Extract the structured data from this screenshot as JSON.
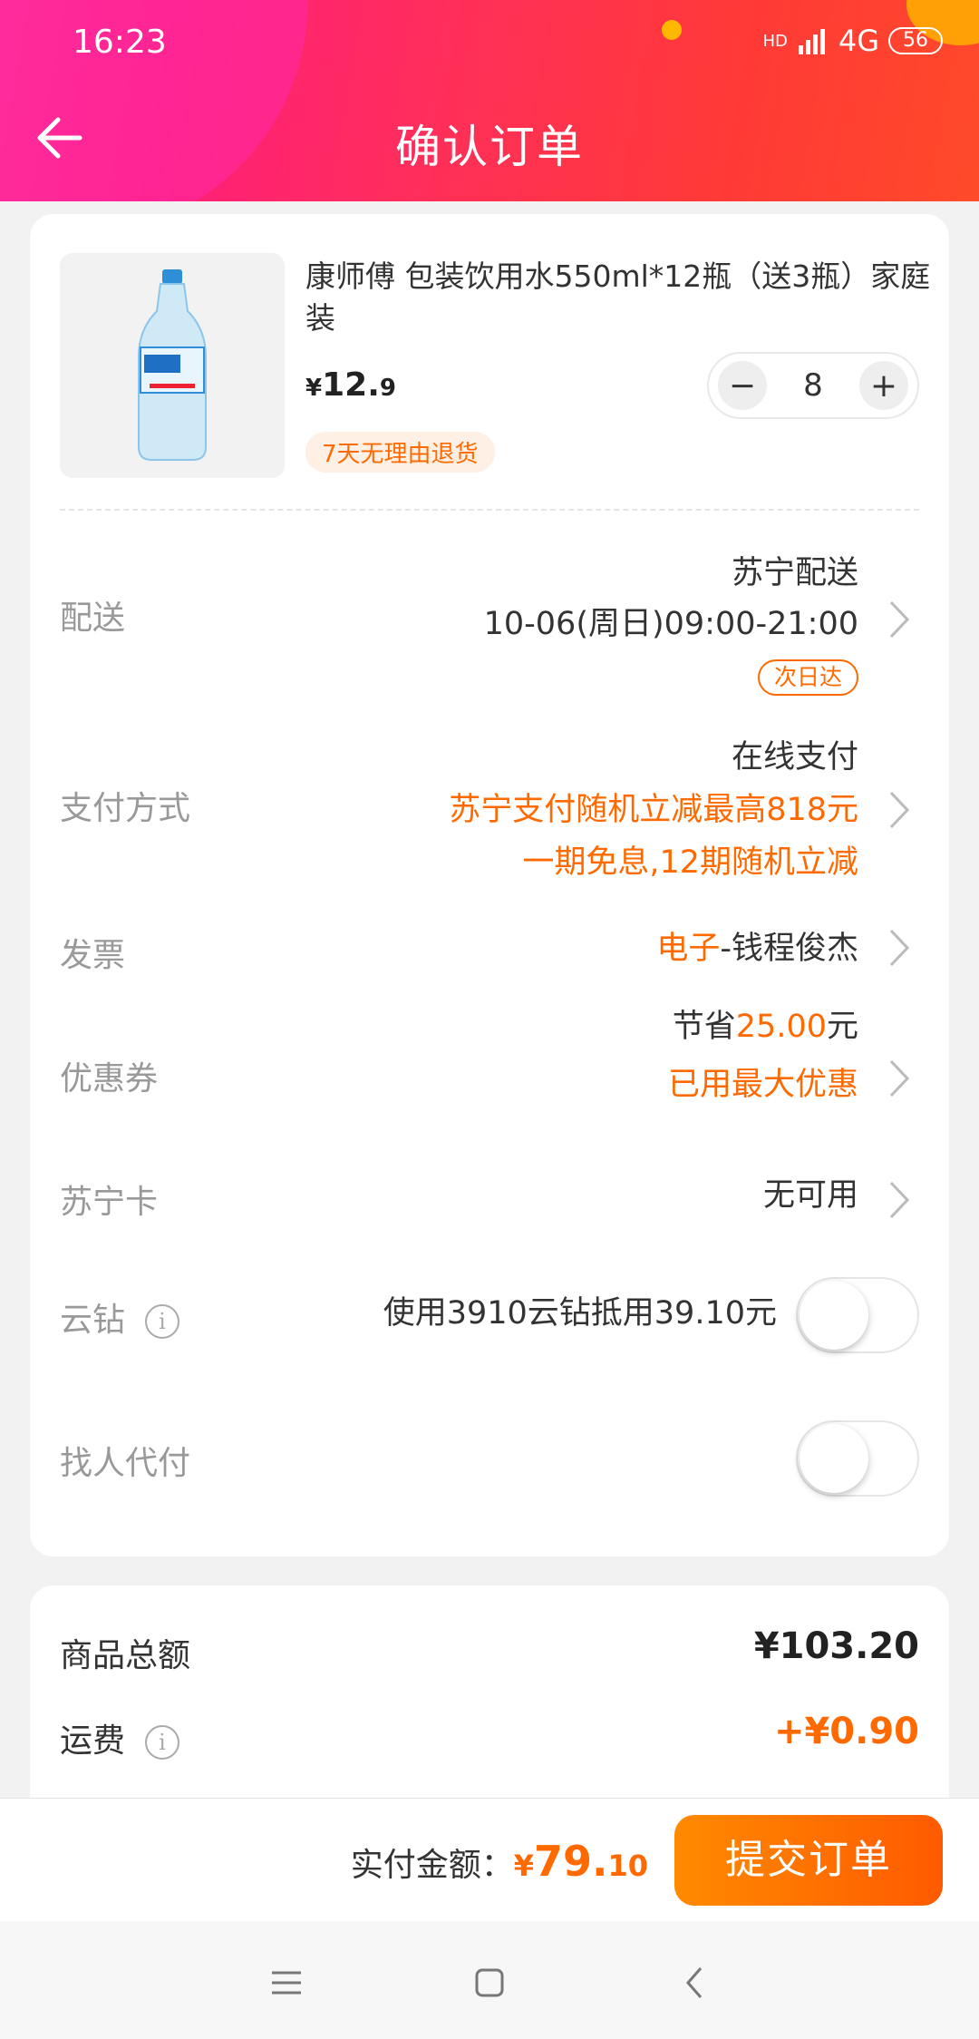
{
  "status_bar": {
    "time": "16:23",
    "network": "4G",
    "signal_label": "HD",
    "battery": "56"
  },
  "header": {
    "title": "确认订单",
    "back_icon": "arrow-left-icon"
  },
  "product": {
    "title": "康师傅 包装饮用水550ml*12瓶（送3瓶）家庭装",
    "price_symbol": "¥",
    "price_int": "12.",
    "price_dec": "9",
    "quantity": "8",
    "minus": "−",
    "plus": "+",
    "return_tag": "7天无理由退货"
  },
  "delivery": {
    "label": "配送",
    "method": "苏宁配送",
    "time": "10-06(周日)09:00-21:00",
    "tag": "次日达"
  },
  "payment": {
    "label": "支付方式",
    "method": "在线支付",
    "promo1": "苏宁支付随机立减最高818元",
    "promo2": "一期免息,12期随机立减"
  },
  "invoice": {
    "label": "发票",
    "type": "电子",
    "name": "-钱程俊杰"
  },
  "coupon": {
    "label": "优惠券",
    "prefix": "节省",
    "amount": "25.00",
    "suffix": "元",
    "note": "已用最大优惠"
  },
  "suning_card": {
    "label": "苏宁卡",
    "value": "无可用"
  },
  "cloud_diamond": {
    "label": "云钻",
    "info": "i",
    "text": "使用3910云钻抵用39.10元",
    "enabled": false
  },
  "pay_for_me": {
    "label": "找人代付",
    "enabled": false
  },
  "summary": {
    "goods_label": "商品总额",
    "goods_value": "¥103.20",
    "shipping_label": "运费",
    "shipping_info": "i",
    "shipping_value": "+¥0.90"
  },
  "bottom": {
    "total_label": "实付金额：",
    "total_symbol": "¥",
    "total_int": "79.",
    "total_dec": "10",
    "submit": "提交订单"
  },
  "colors": {
    "accent": "#ff6a00",
    "header_start": "#ff2d8f",
    "header_end": "#ff4a2a"
  }
}
